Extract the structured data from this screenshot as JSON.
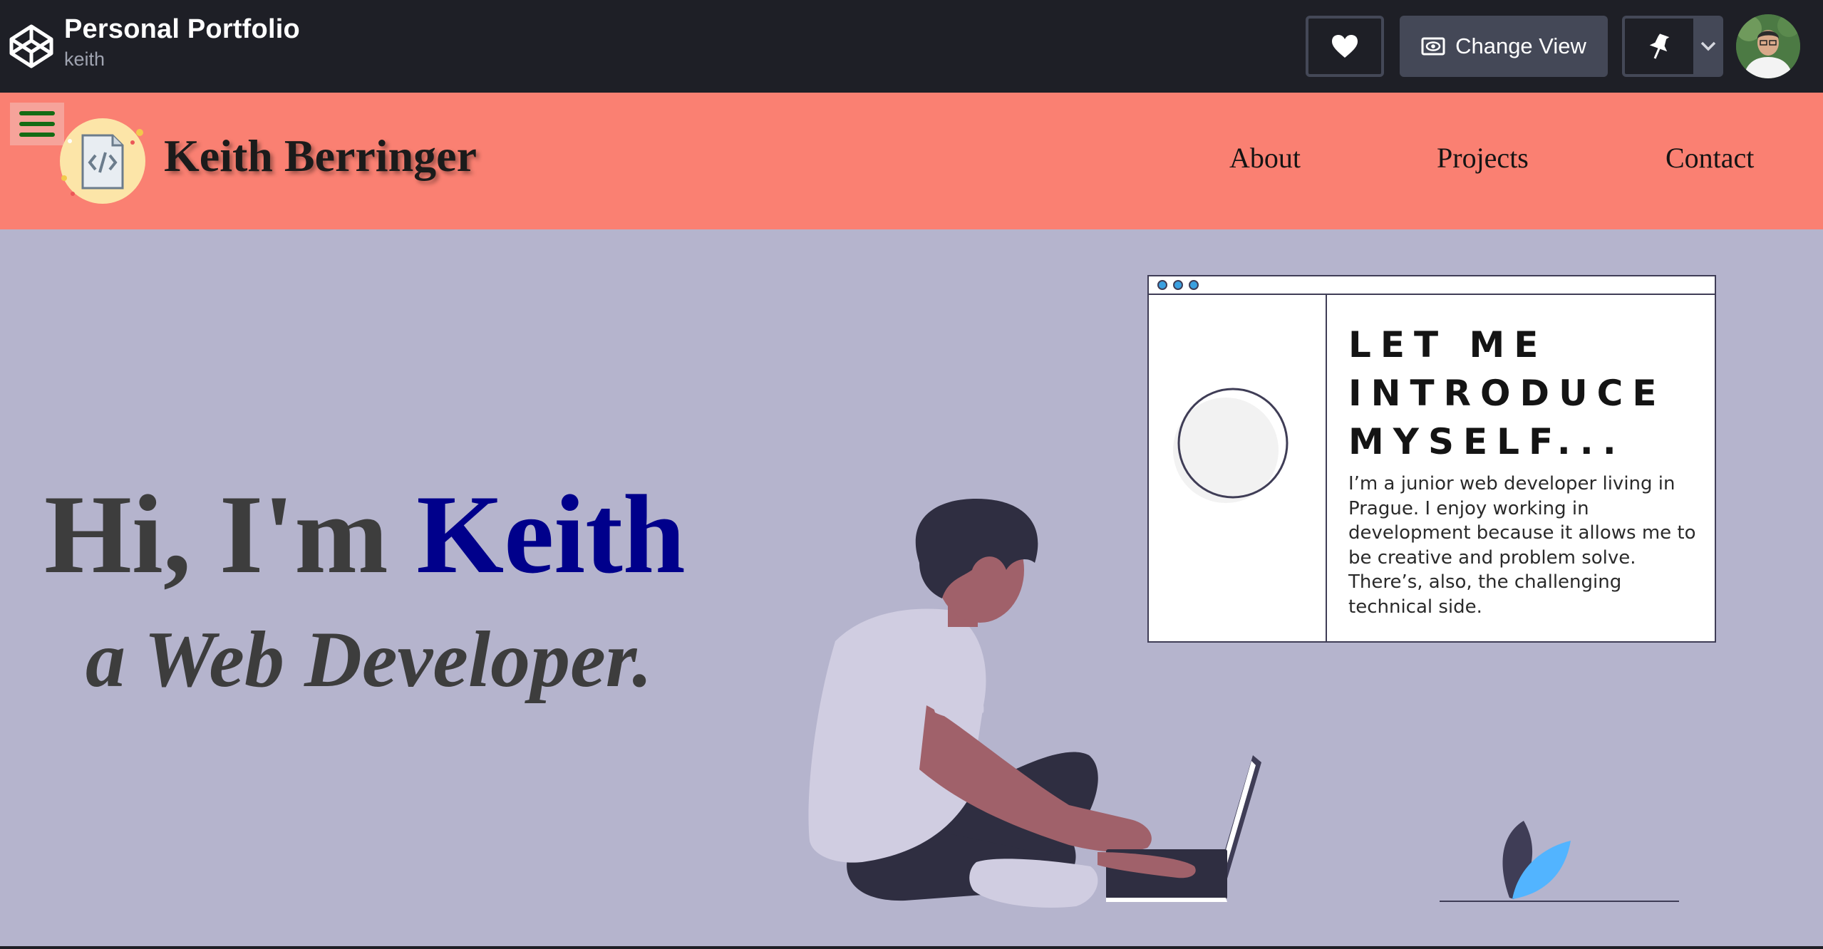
{
  "topbar": {
    "title": "Personal Portfolio",
    "user": "keith",
    "change_view_label": "Change View",
    "icons": [
      "codepen-logo-icon",
      "heart-icon",
      "eye-icon",
      "pin-icon",
      "chevron-down-icon"
    ],
    "colors": {
      "background": "#1e1f26",
      "button": "#444857",
      "text": "#ffffff"
    }
  },
  "site": {
    "name": "Keith Berringer",
    "nav": [
      "About",
      "Projects",
      "Contact"
    ],
    "colors": {
      "header": "#fa8072",
      "hero_background": "#b5b4cd",
      "accent_name": "#00008b",
      "menu_icon": "#146b14"
    }
  },
  "hero": {
    "greeting": "Hi, I'm ",
    "name": "Keith",
    "subtitle": "a Web Developer."
  },
  "card": {
    "heading": "LET ME INTRODUCE MYSELF...",
    "text": "I’m a junior web developer living in Prague. I enjoy working in development because it allows me to be creative and problem solve. There’s, also, the challenging technical side."
  }
}
